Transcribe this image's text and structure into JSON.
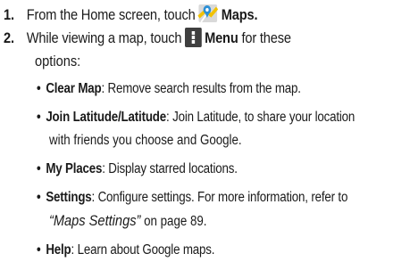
{
  "steps": [
    {
      "number": "1.",
      "text_before": "From the Home screen, touch",
      "icon": "maps-app-icon",
      "bold": "Maps",
      "text_after": "."
    },
    {
      "number": "2.",
      "text_before": "While viewing a map, touch",
      "icon": "menu-key-icon",
      "bold": "Menu",
      "text_after": " for these",
      "continuation": "options:"
    }
  ],
  "options": [
    {
      "term": "Clear Map",
      "line1": ": Remove search results from the map."
    },
    {
      "term": "Join Latitude/Latitude",
      "line1": ": Join Latitude, to share your location",
      "line2": "with friends you choose and Google."
    },
    {
      "term": "My Places",
      "line1": ": Display starred locations."
    },
    {
      "term": "Settings",
      "line1": ": Configure settings. For more information, refer to",
      "xref": "“Maps Settings”",
      "xref_after": "  on page 89."
    },
    {
      "term": "Help",
      "line1": ": Learn about Google maps."
    }
  ],
  "colors": {
    "text": "#1a1a1a",
    "maps_icon_bg": "#d9d9d9",
    "maps_icon_road": "#f2c200",
    "maps_icon_pin": "#2b8fd6",
    "menu_icon_bg": "#3f3f3f"
  },
  "bullet_char": "•"
}
